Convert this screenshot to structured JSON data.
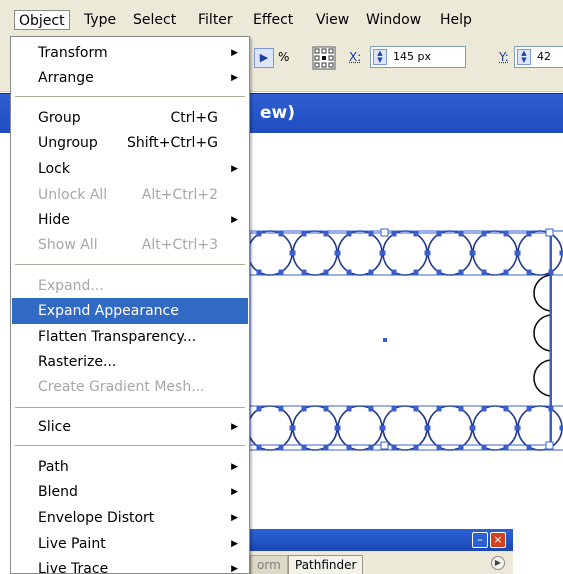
{
  "menubar": {
    "items": [
      "Object",
      "Type",
      "Select",
      "Filter",
      "Effect",
      "View",
      "Window",
      "Help"
    ]
  },
  "toolbar": {
    "percent_symbol": "%",
    "x_label": "X:",
    "x_value": "145 px",
    "y_label": "Y:",
    "y_value": "42"
  },
  "document": {
    "title_fragment": "ew)"
  },
  "object_menu": {
    "transform": "Transform",
    "arrange": "Arrange",
    "group": "Group",
    "group_shortcut": "Ctrl+G",
    "ungroup": "Ungroup",
    "ungroup_shortcut": "Shift+Ctrl+G",
    "lock": "Lock",
    "unlock_all": "Unlock All",
    "unlock_all_shortcut": "Alt+Ctrl+2",
    "hide": "Hide",
    "show_all": "Show All",
    "show_all_shortcut": "Alt+Ctrl+3",
    "expand": "Expand...",
    "expand_appearance": "Expand Appearance",
    "flatten_transparency": "Flatten Transparency...",
    "rasterize": "Rasterize...",
    "create_gradient_mesh": "Create Gradient Mesh...",
    "slice": "Slice",
    "path": "Path",
    "blend": "Blend",
    "envelope_distort": "Envelope Distort",
    "live_paint": "Live Paint",
    "live_trace": "Live Trace"
  },
  "panel": {
    "tab_partial": "orm",
    "tab_pathfinder": "Pathfinder"
  },
  "colors": {
    "highlight": "#316ac5",
    "selection_blue": "#3a5fcd",
    "titlebar": "#2f5fd0",
    "menu_bg": "#ece9d8"
  }
}
